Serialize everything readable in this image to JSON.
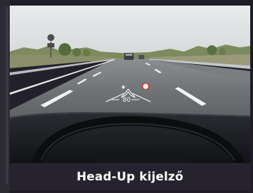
{
  "caption": {
    "text": "Head-Up kijelző"
  },
  "hud": {
    "speed": "80",
    "speed_sign_icon": "speed-limit-sign-icon",
    "direction_icon": "navigation-arrow-icon"
  },
  "colors": {
    "caption_bg": "#26232e",
    "caption_text": "#ffffff",
    "sky": "#dfe3e4",
    "road": "#65686b",
    "dashboard": "#1b1d21"
  }
}
